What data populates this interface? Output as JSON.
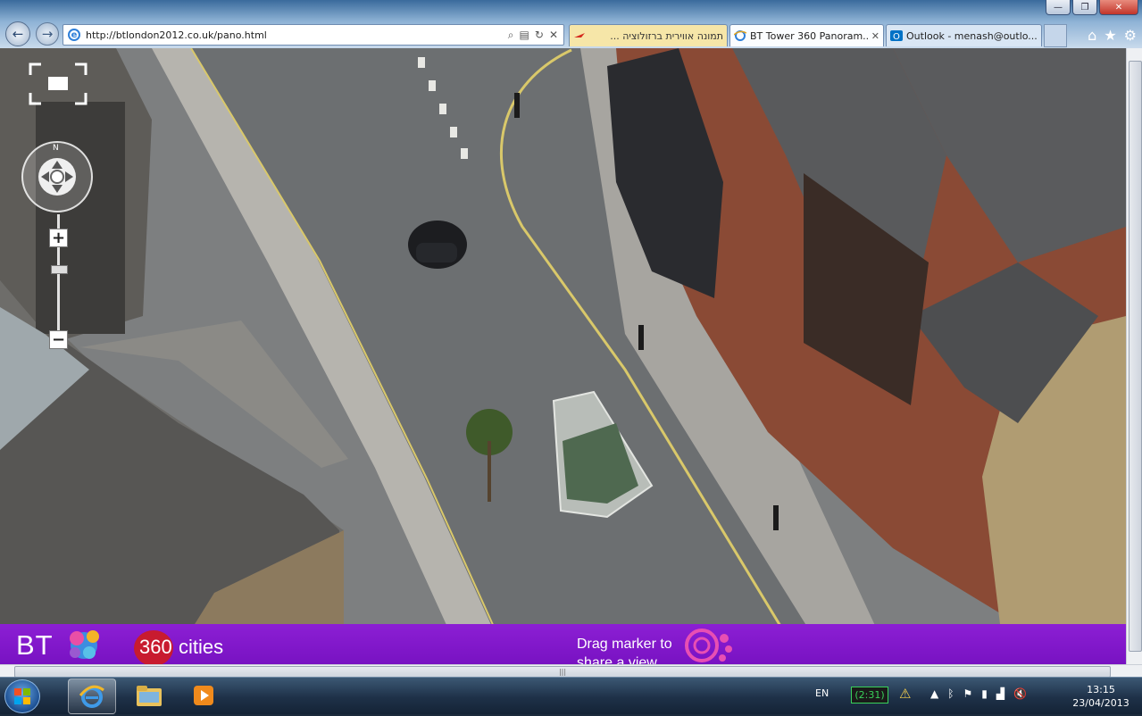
{
  "window": {
    "caption_minimize": "—",
    "caption_maximize": "❐",
    "caption_close": "✕"
  },
  "toolbar": {
    "back_icon": "←",
    "forward_icon": "→",
    "address_url": "http://btlondon2012.co.uk/pano.html",
    "search_icon": "⌕",
    "compat_icon": "▤",
    "refresh_icon": "↻",
    "stop_icon": "✕",
    "home_icon": "⌂",
    "favorites_icon": "★",
    "tools_icon": "⚙"
  },
  "tabs": [
    {
      "label": "תמונה אווירית ברזולוציה ...",
      "icon": "airline-favicon-icon",
      "active": false
    },
    {
      "label": "BT Tower 360 Panoram...",
      "icon": "ie-favicon-icon",
      "active": true,
      "close": "✕"
    },
    {
      "label": "Outlook - menash@outlo...",
      "icon": "outlook-favicon-icon",
      "active": false
    }
  ],
  "pano": {
    "compass_n": "N",
    "zoom_in": "+",
    "zoom_out": "−",
    "zoom_level_fraction": 0.2,
    "footer": {
      "bt_logo": "BT",
      "cities_num": "360",
      "cities_word": "cities",
      "drag_text": "Drag marker to share a view"
    },
    "colors": {
      "footer_purple": "#7d14c8",
      "cities_red": "#c81b2f"
    }
  },
  "scrollbar": {
    "grip": "|||"
  },
  "taskbar": {
    "apps": [
      {
        "name": "internet-explorer",
        "active": true
      },
      {
        "name": "windows-explorer",
        "active": false
      },
      {
        "name": "windows-media-player",
        "active": false
      }
    ],
    "language": "EN",
    "battery_chip": "(2:31)",
    "clock_time": "13:15",
    "clock_date": "23/04/2013"
  }
}
